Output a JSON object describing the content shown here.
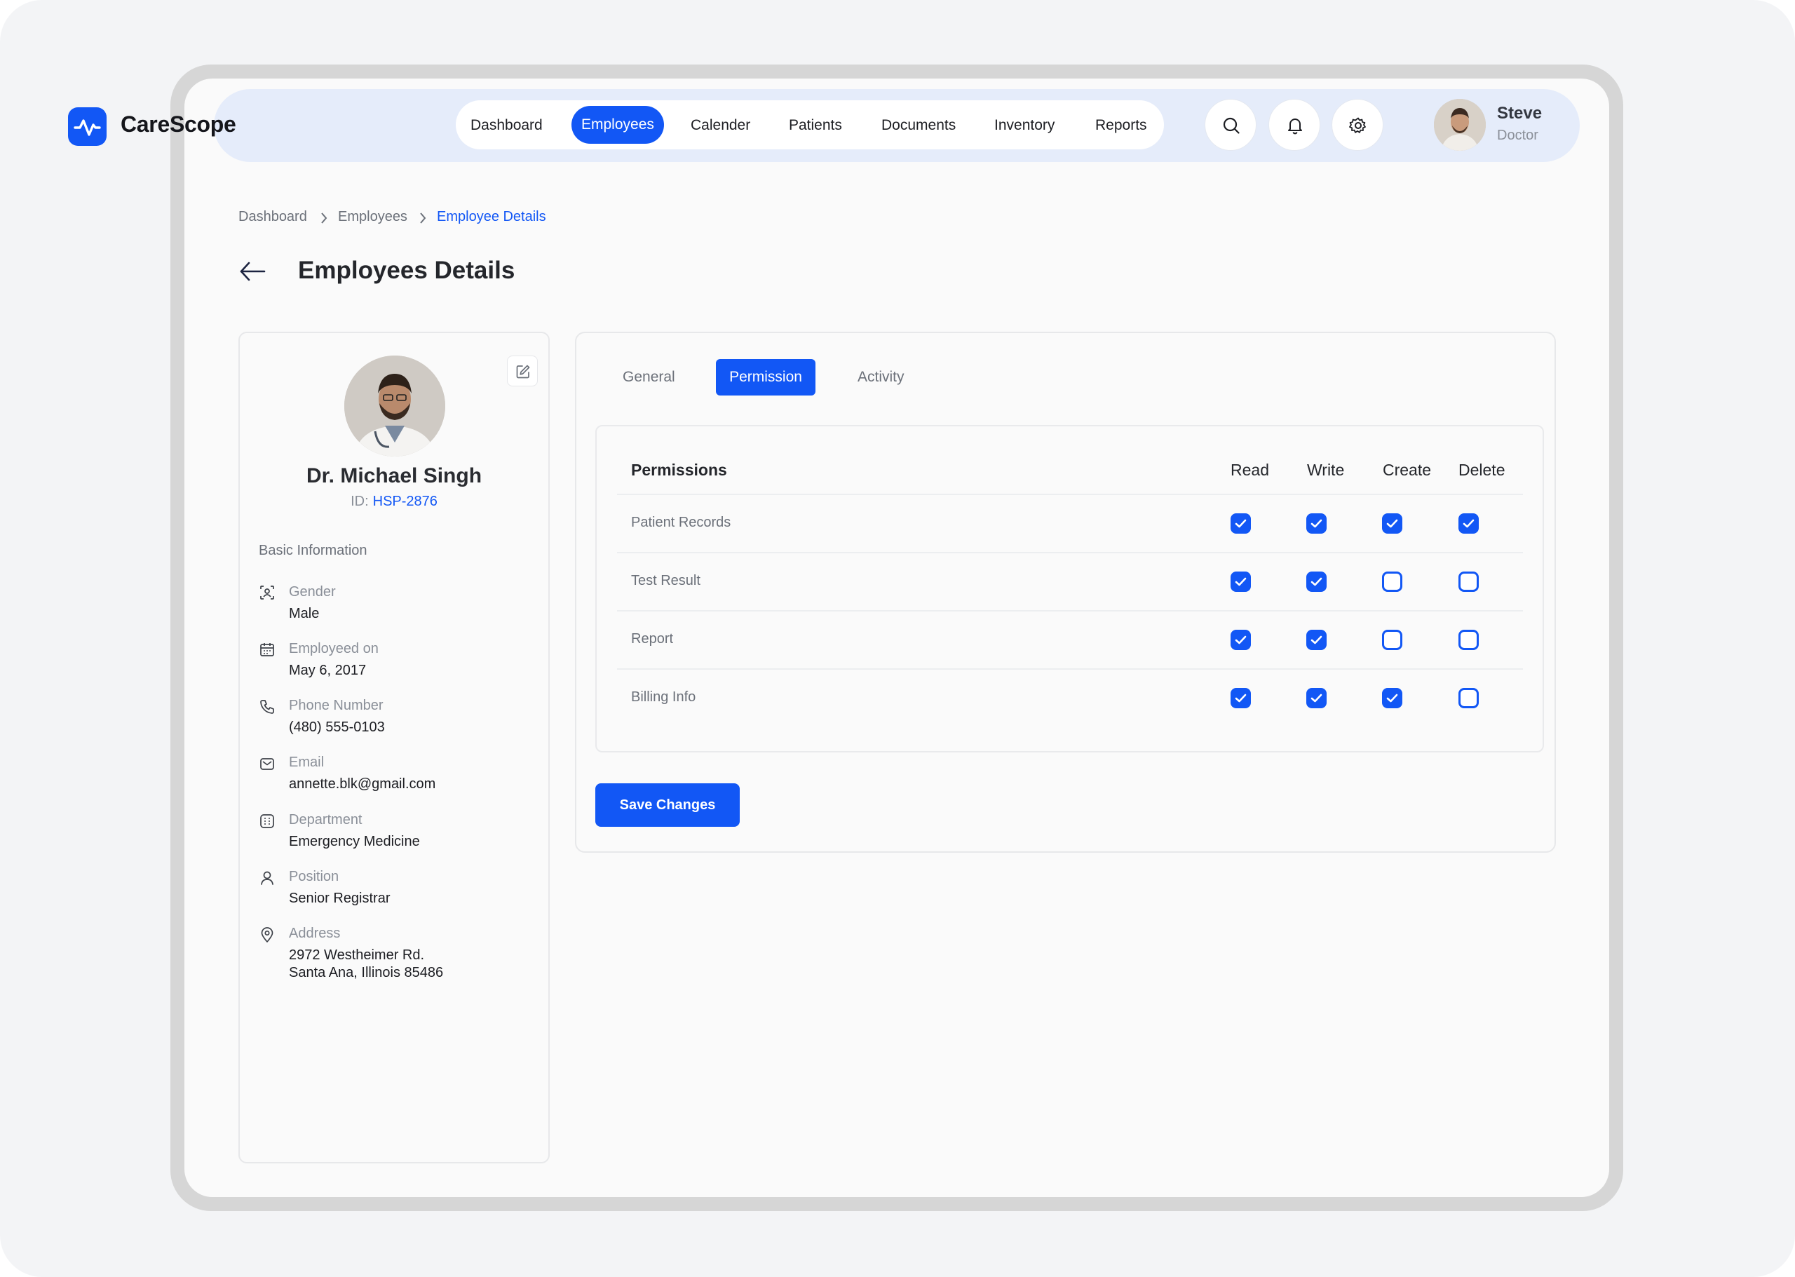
{
  "app": {
    "brand": "CareScope",
    "accent_color": "#1257f5"
  },
  "nav": {
    "items": [
      {
        "label": "Dashboard",
        "active": false
      },
      {
        "label": "Employees",
        "active": true
      },
      {
        "label": "Calender",
        "active": false
      },
      {
        "label": "Patients",
        "active": false
      },
      {
        "label": "Documents",
        "active": false
      },
      {
        "label": "Inventory",
        "active": false
      },
      {
        "label": "Reports",
        "active": false
      }
    ],
    "icons": [
      "search-icon",
      "bell-icon",
      "gear-icon"
    ]
  },
  "user": {
    "name": "Steve",
    "role": "Doctor"
  },
  "breadcrumb": [
    "Dashboard",
    "Employees",
    "Employee Details"
  ],
  "page": {
    "title": "Employees Details"
  },
  "profile": {
    "name": "Dr. Michael Singh",
    "id_label": "ID:",
    "id_value": "HSP-2876",
    "section": "Basic Information",
    "fields": [
      {
        "icon": "gender-icon",
        "label": "Gender",
        "value": "Male"
      },
      {
        "icon": "calendar-icon",
        "label": "Employeed on",
        "value": "May 6, 2017"
      },
      {
        "icon": "phone-icon",
        "label": "Phone Number",
        "value": "(480) 555-0103"
      },
      {
        "icon": "mail-icon",
        "label": "Email",
        "value": "annette.blk@gmail.com"
      },
      {
        "icon": "building-icon",
        "label": "Department",
        "value": "Emergency Medicine"
      },
      {
        "icon": "person-icon",
        "label": "Position",
        "value": "Senior Registrar"
      },
      {
        "icon": "location-icon",
        "label": "Address",
        "value": "2972 Westheimer Rd.",
        "value2": "Santa Ana, Illinois 85486"
      }
    ]
  },
  "tabs": [
    {
      "label": "General",
      "active": false
    },
    {
      "label": "Permission",
      "active": true
    },
    {
      "label": "Activity",
      "active": false
    }
  ],
  "permissions": {
    "header": "Permissions",
    "columns": [
      "Read",
      "Write",
      "Create",
      "Delete"
    ],
    "rows": [
      {
        "label": "Patient Records",
        "values": [
          true,
          true,
          true,
          true
        ]
      },
      {
        "label": "Test Result",
        "values": [
          true,
          true,
          false,
          false
        ]
      },
      {
        "label": "Report",
        "values": [
          true,
          true,
          false,
          false
        ]
      },
      {
        "label": "Billing Info",
        "values": [
          true,
          true,
          true,
          false
        ]
      }
    ]
  },
  "actions": {
    "save_label": "Save Changes"
  }
}
